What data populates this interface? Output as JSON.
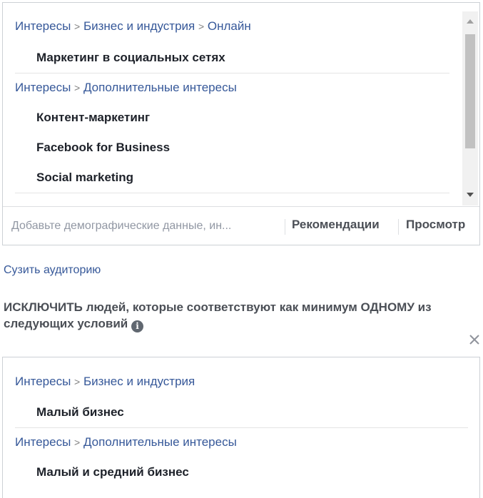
{
  "include": {
    "groups": [
      {
        "path": [
          "Интересы",
          "Бизнес и индустрия",
          "Онлайн"
        ],
        "items": [
          "Маркетинг в социальных сетях"
        ]
      },
      {
        "path": [
          "Интересы",
          "Дополнительные интересы"
        ],
        "items": [
          "Контент-маркетинг",
          "Facebook for Business",
          "Social marketing"
        ]
      }
    ],
    "separator": ">"
  },
  "footer": {
    "placeholder": "Добавьте демографические данные, ин...",
    "recommendations_label": "Рекомендации",
    "browse_label": "Просмотр"
  },
  "narrow_audience_label": "Сузить аудиторию",
  "exclude": {
    "heading": "ИСКЛЮЧИТЬ людей, которые соответствуют как минимум ОДНОМУ из следующих условий",
    "info_icon": "i",
    "close_icon": "close-icon",
    "groups": [
      {
        "path": [
          "Интересы",
          "Бизнес и индустрия"
        ],
        "items": [
          "Малый бизнес"
        ]
      },
      {
        "path": [
          "Интересы",
          "Дополнительные интересы"
        ],
        "items": [
          "Малый и средний бизнес"
        ]
      }
    ]
  },
  "colors": {
    "link": "#365899",
    "text": "#1d2129",
    "muted": "#9197a3",
    "border": "#ccd0d5"
  }
}
